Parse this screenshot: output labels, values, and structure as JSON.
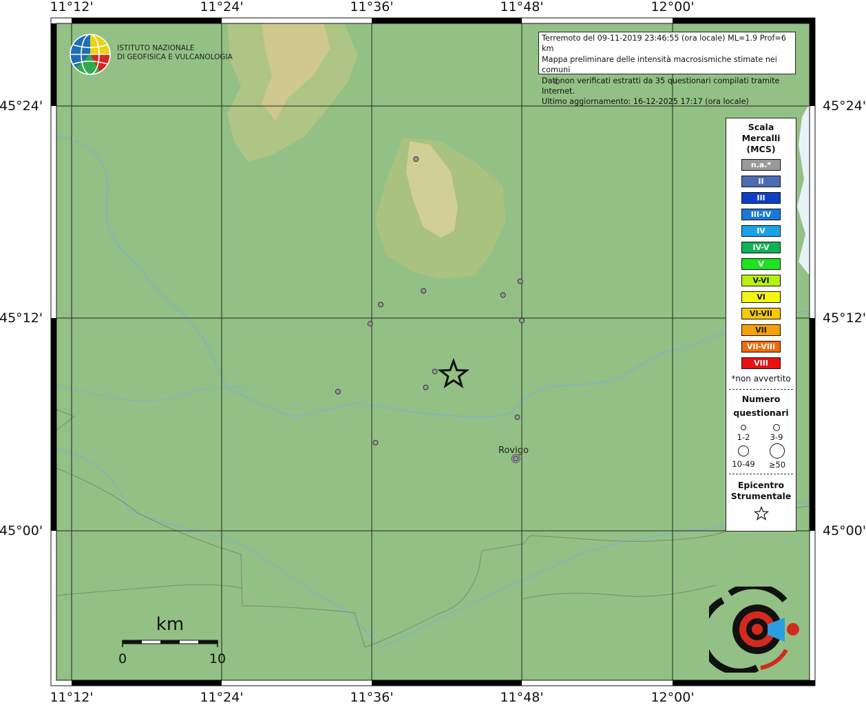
{
  "axes": {
    "longitude_labels": [
      "11°12'",
      "11°24'",
      "11°36'",
      "11°48'",
      "12°00'"
    ],
    "latitude_labels": [
      "45°24'",
      "45°12'",
      "45°00'"
    ]
  },
  "institute": {
    "line1": "ISTITUTO NAZIONALE",
    "line2": "DI GEOFISICA E VULCANOLOGIA"
  },
  "info": {
    "line1": "Terremoto del 09-11-2019 23:46:55 (ora locale) ML=1.9 Prof=6 km",
    "line2": "Mappa preliminare delle intensità macrosismiche stimate nei comuni",
    "line3": "Dati non verificati estratti da 35 questionari compilati tramite Internet.",
    "line4": "Ultimo aggiornamento: 16-12-2025 17:17 (ora locale)"
  },
  "legend": {
    "title1": "Scala",
    "title2": "Mercalli",
    "title3": "(MCS)",
    "items": [
      {
        "label": "n.a.*",
        "color": "#9a9a9a"
      },
      {
        "label": "II",
        "color": "#4d6db3"
      },
      {
        "label": "III",
        "color": "#0d3fc4"
      },
      {
        "label": "III-IV",
        "color": "#1a78d6"
      },
      {
        "label": "IV",
        "color": "#1ba3e6"
      },
      {
        "label": "IV-V",
        "color": "#10b256"
      },
      {
        "label": "V",
        "color": "#1fe21f"
      },
      {
        "label": "V-VI",
        "color": "#b5f20e"
      },
      {
        "label": "VI",
        "color": "#f5f50d"
      },
      {
        "label": "VI-VII",
        "color": "#f5c80a"
      },
      {
        "label": "VII",
        "color": "#f5a00a"
      },
      {
        "label": "VII-VIII",
        "color": "#f06a0a"
      },
      {
        "label": "VIII",
        "color": "#e81010"
      }
    ],
    "note": "*non avvertito",
    "count_title1": "Numero",
    "count_title2": "questionari",
    "count_classes": [
      "1-2",
      "3-9",
      "10-49",
      "≥50"
    ],
    "epicenter_title1": "Epicentro",
    "epicenter_title2": "Strumentale"
  },
  "scale_bar": {
    "unit": "km",
    "start": "0",
    "end": "10"
  },
  "city": "Rovigo",
  "points": [
    {
      "lon": 11.847,
      "lat": 45.423
    },
    {
      "lon": 11.659,
      "lat": 45.35
    },
    {
      "lon": 11.798,
      "lat": 45.235
    },
    {
      "lon": 11.669,
      "lat": 45.226
    },
    {
      "lon": 11.775,
      "lat": 45.222
    },
    {
      "lon": 11.612,
      "lat": 45.213
    },
    {
      "lon": 11.8,
      "lat": 45.198
    },
    {
      "lon": 11.598,
      "lat": 45.195
    },
    {
      "lon": 11.684,
      "lat": 45.15
    },
    {
      "lon": 11.672,
      "lat": 45.135
    },
    {
      "lon": 11.555,
      "lat": 45.131
    },
    {
      "lon": 11.794,
      "lat": 45.107
    },
    {
      "lon": 11.605,
      "lat": 45.083
    },
    {
      "lon": 11.792,
      "lat": 45.068
    }
  ],
  "epicenter": {
    "lon": 11.709,
    "lat": 45.147
  },
  "colors": {
    "land": "#93c084",
    "hills": "#c7c98e",
    "peak": "#e6dcaa",
    "river": "#7fb3c9",
    "border": "#7a8a78",
    "sea": "#e6f2f7"
  }
}
